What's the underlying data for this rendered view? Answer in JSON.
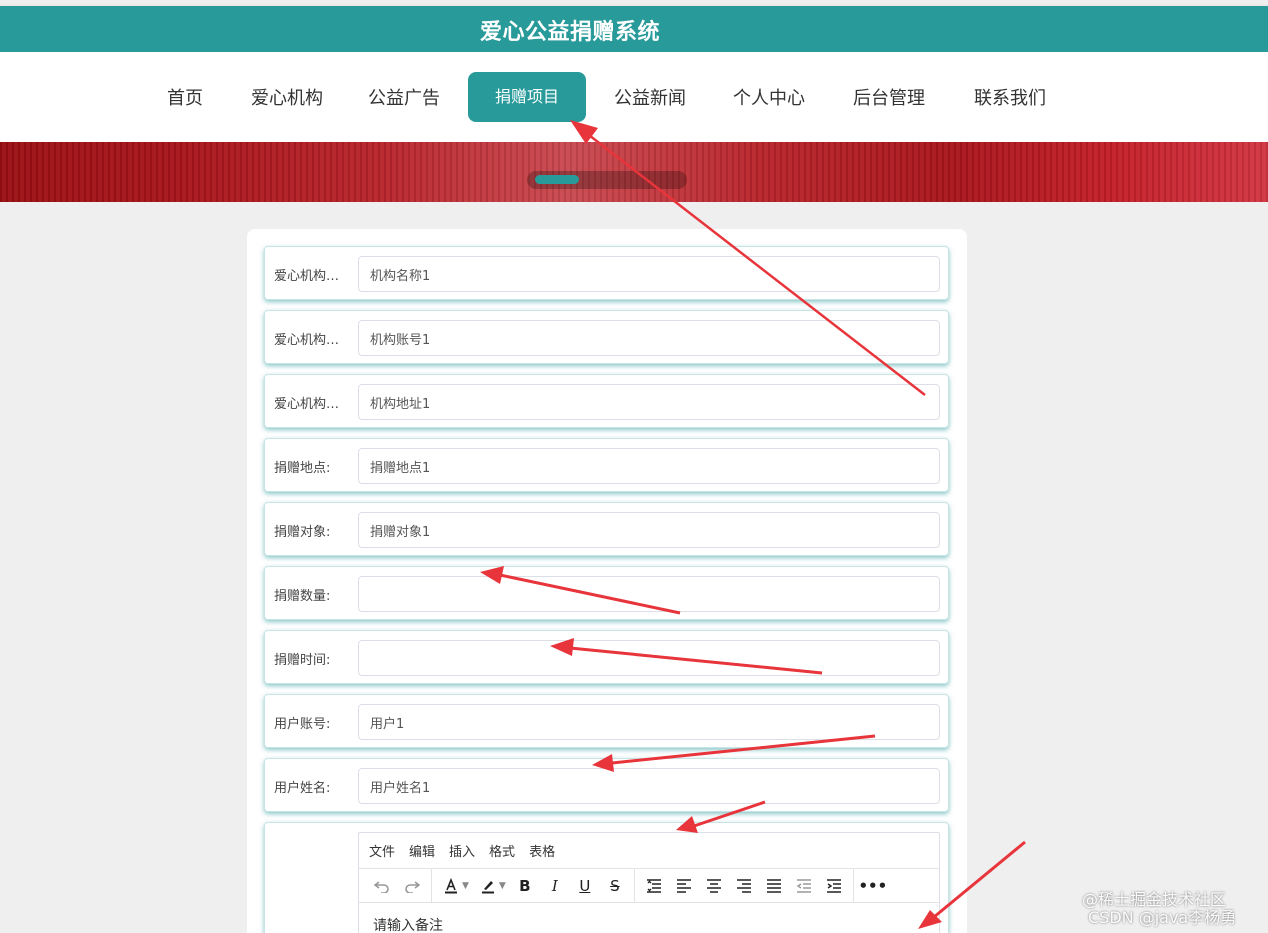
{
  "app": {
    "title": "爱心公益捐赠系统"
  },
  "nav": {
    "items": [
      {
        "label": "首页"
      },
      {
        "label": "爱心机构"
      },
      {
        "label": "公益广告"
      },
      {
        "label": "捐赠项目",
        "active": true
      },
      {
        "label": "公益新闻"
      },
      {
        "label": "个人中心"
      },
      {
        "label": "后台管理"
      },
      {
        "label": "联系我们"
      }
    ]
  },
  "form": {
    "fields": [
      {
        "label": "爱心机构名称:",
        "value": "机构名称1"
      },
      {
        "label": "爱心机构账号:",
        "value": "机构账号1"
      },
      {
        "label": "爱心机构地址:",
        "value": "机构地址1"
      },
      {
        "label": "捐赠地点:",
        "value": "捐赠地点1"
      },
      {
        "label": "捐赠对象:",
        "value": "捐赠对象1"
      },
      {
        "label": "捐赠数量:",
        "value": ""
      },
      {
        "label": "捐赠时间:",
        "value": ""
      },
      {
        "label": "用户账号:",
        "value": "用户1"
      },
      {
        "label": "用户姓名:",
        "value": "用户姓名1"
      }
    ],
    "editor": {
      "menu": [
        "文件",
        "编辑",
        "插入",
        "格式",
        "表格"
      ],
      "placeholder": "请输入备注"
    }
  },
  "watermark": {
    "line1": "@稀土掘金技术社区",
    "line2": "CSDN @java李杨勇"
  },
  "colors": {
    "accent": "#289a9a",
    "banner": "#b8232a",
    "annotation_arrow": "#e8343b"
  }
}
